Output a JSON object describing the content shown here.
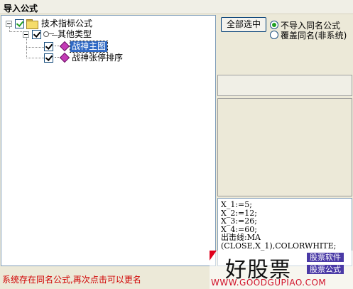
{
  "window": {
    "title": "导入公式"
  },
  "tree": {
    "root": {
      "label": "技术指标公式",
      "checked": true
    },
    "group": {
      "label": "其他类型",
      "checked": true
    },
    "items": [
      {
        "label": "战神主图",
        "checked": true,
        "selected": true
      },
      {
        "label": "战神张停排序",
        "checked": true,
        "selected": false
      }
    ]
  },
  "options": {
    "select_all_label": "全部选中",
    "radio": [
      {
        "label": "不导入同名公式",
        "selected": true
      },
      {
        "label": "覆盖同名(非系统)",
        "selected": false
      }
    ]
  },
  "code_preview": {
    "lines": [
      "X_1:=5;",
      "X_2:=12;",
      "X_3:=26;",
      "X_4:=60;",
      "出击线:MA",
      "(CLOSE,X_1),COLORWHITE;"
    ]
  },
  "status": {
    "text": "系统存在同名公式,再次点击可以更名"
  },
  "watermark": {
    "brand": "好股票",
    "tags": [
      "股票软件",
      "股票公式"
    ],
    "url": "WWW.GOODGUPIAO.COM"
  },
  "colors": {
    "selection": "#316ac5",
    "status_text": "#d00000",
    "checkmark": "#21a121"
  },
  "icons": [
    "folder-icon",
    "key-icon",
    "formula-icon"
  ]
}
